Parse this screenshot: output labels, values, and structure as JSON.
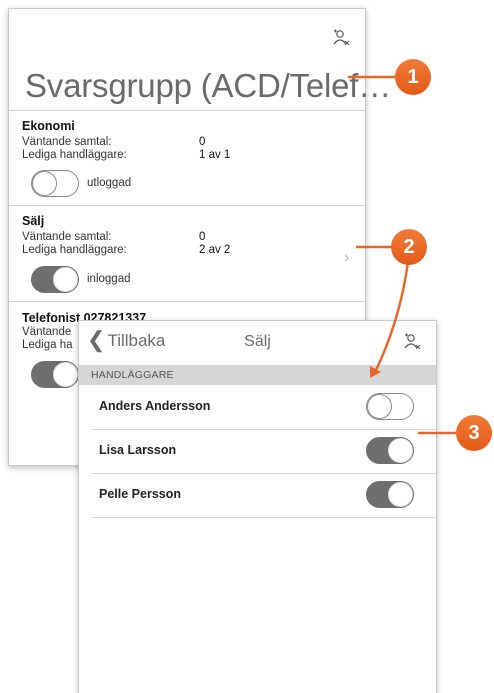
{
  "back_panel": {
    "title": "Svarsgrupp (ACD/Telef…",
    "header_icon": "user-switch-icon",
    "groups": [
      {
        "name": "Ekonomi",
        "waiting_label": "Väntande samtal:",
        "waiting_value": "0",
        "available_label": "Lediga handläggare:",
        "available_value": "1 av 1",
        "toggle_state": "off",
        "toggle_label": "utloggad"
      },
      {
        "name": "Sälj",
        "waiting_label": "Väntande samtal:",
        "waiting_value": "0",
        "available_label": "Lediga handläggare:",
        "available_value": "2 av 2",
        "toggle_state": "on",
        "toggle_label": "inloggad",
        "chevron": "chevron-right-icon"
      },
      {
        "name": "Telefonist 027821337",
        "waiting_label": "Väntande",
        "available_label": "Lediga ha",
        "toggle_state": "on"
      }
    ]
  },
  "front_panel": {
    "back_label": "Tillbaka",
    "title": "Sälj",
    "header_icon": "user-switch-icon",
    "section_header": "HANDLÄGGARE",
    "agents": [
      {
        "name": "Anders Andersson",
        "toggle_state": "off"
      },
      {
        "name": "Lisa Larsson",
        "toggle_state": "on"
      },
      {
        "name": "Pelle Persson",
        "toggle_state": "on"
      }
    ]
  },
  "callouts": [
    "1",
    "2",
    "3"
  ],
  "colors": {
    "accent": "#e8662a",
    "toggle_on": "#6e6e6e",
    "section_bg": "#d6d6d6"
  }
}
